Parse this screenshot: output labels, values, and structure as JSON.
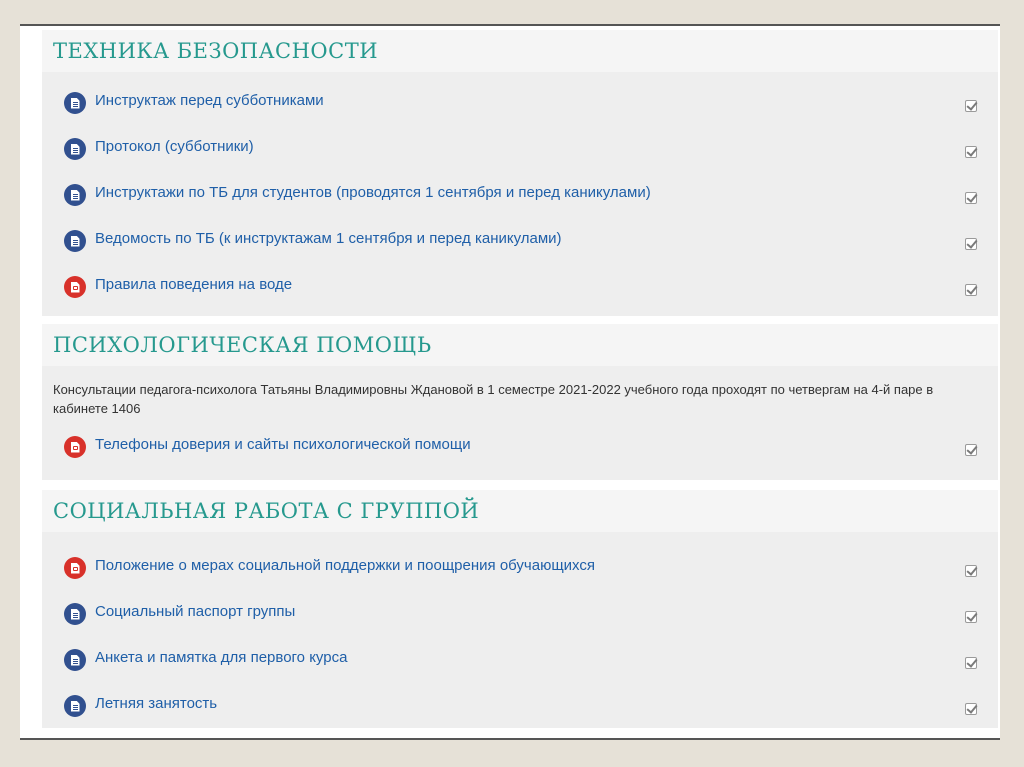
{
  "sections": [
    {
      "title": "ТЕХНИКА БЕЗОПАСНОСТИ",
      "items": [
        {
          "label": "Инструктаж перед субботниками",
          "icon": "word-document-icon"
        },
        {
          "label": "Протокол (субботники)",
          "icon": "word-document-icon"
        },
        {
          "label": "Инструктажи по ТБ для студентов (проводятся 1 сентября и перед каникулами)",
          "icon": "word-document-icon"
        },
        {
          "label": "Ведомость по ТБ (к инструктажам 1 сентября и перед каникулами)",
          "icon": "word-document-icon"
        },
        {
          "label": "Правила поведения на воде",
          "icon": "pdf-document-icon"
        }
      ]
    },
    {
      "title": "ПСИХОЛОГИЧЕСКАЯ ПОМОЩЬ",
      "summary": "Консультации педагога-психолога Татьяны Владимировны Ждановой в 1 семестре 2021-2022 учебного года проходят по четвергам на 4-й паре в кабинете 1406",
      "items": [
        {
          "label": "Телефоны доверия и сайты психологической помощи",
          "icon": "pdf-document-icon"
        }
      ]
    },
    {
      "title": "СОЦИАЛЬНАЯ РАБОТА С ГРУППОЙ",
      "items": [
        {
          "label": "Положение о мерах социальной поддержки и поощрения обучающихся",
          "icon": "pdf-document-icon"
        },
        {
          "label": "Социальный паспорт группы",
          "icon": "word-document-icon"
        },
        {
          "label": "Анкета и памятка для первого курса",
          "icon": "word-document-icon"
        },
        {
          "label": "Летняя занятость",
          "icon": "word-document-icon"
        }
      ]
    }
  ],
  "colors": {
    "section_title": "#26998e",
    "link": "#1f5fa8",
    "word_icon": "#31508f",
    "pdf_icon": "#d8312a"
  }
}
